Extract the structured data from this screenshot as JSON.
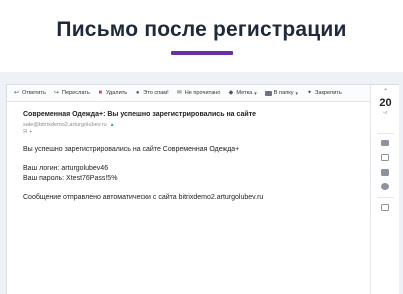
{
  "page": {
    "heading": "Письмо после регистрации"
  },
  "toolbar": {
    "reply": "Ответить",
    "forward": "Переслать",
    "delete": "Удалить",
    "spam": "Это спам!",
    "unread": "Не прочитано",
    "label": "Метка",
    "to_folder": "В папку",
    "pin": "Закрепить"
  },
  "email": {
    "subject": "Современная Одежда+: Вы успешно зарегистрировались на сайте",
    "sender": "sale@bitrixdemo2.arturgolubev.ru",
    "recipient": "Я",
    "lines": [
      "Вы успешно зарегистрировались на сайте Современная Одежда+",
      "Ваш логин: arturgolubev46",
      "Ваш пароль: Xtest76Pass!5%",
      "Сообщение отправлено автоматически с сайта bitrixdemo2.arturgolubev.ru"
    ]
  },
  "calendar": {
    "day_number": "20",
    "day_label": "чт"
  },
  "colors": {
    "accent": "#6b2fa6",
    "delete": "#d94b3f",
    "verified": "#3da35d",
    "background": "#eef2f6"
  },
  "icons": [
    "reply-icon",
    "forward-icon",
    "trash-icon",
    "spam-icon",
    "unread-icon",
    "tag-icon",
    "folder-icon",
    "pin-icon",
    "chevron-up-icon",
    "shield-check-icon"
  ]
}
